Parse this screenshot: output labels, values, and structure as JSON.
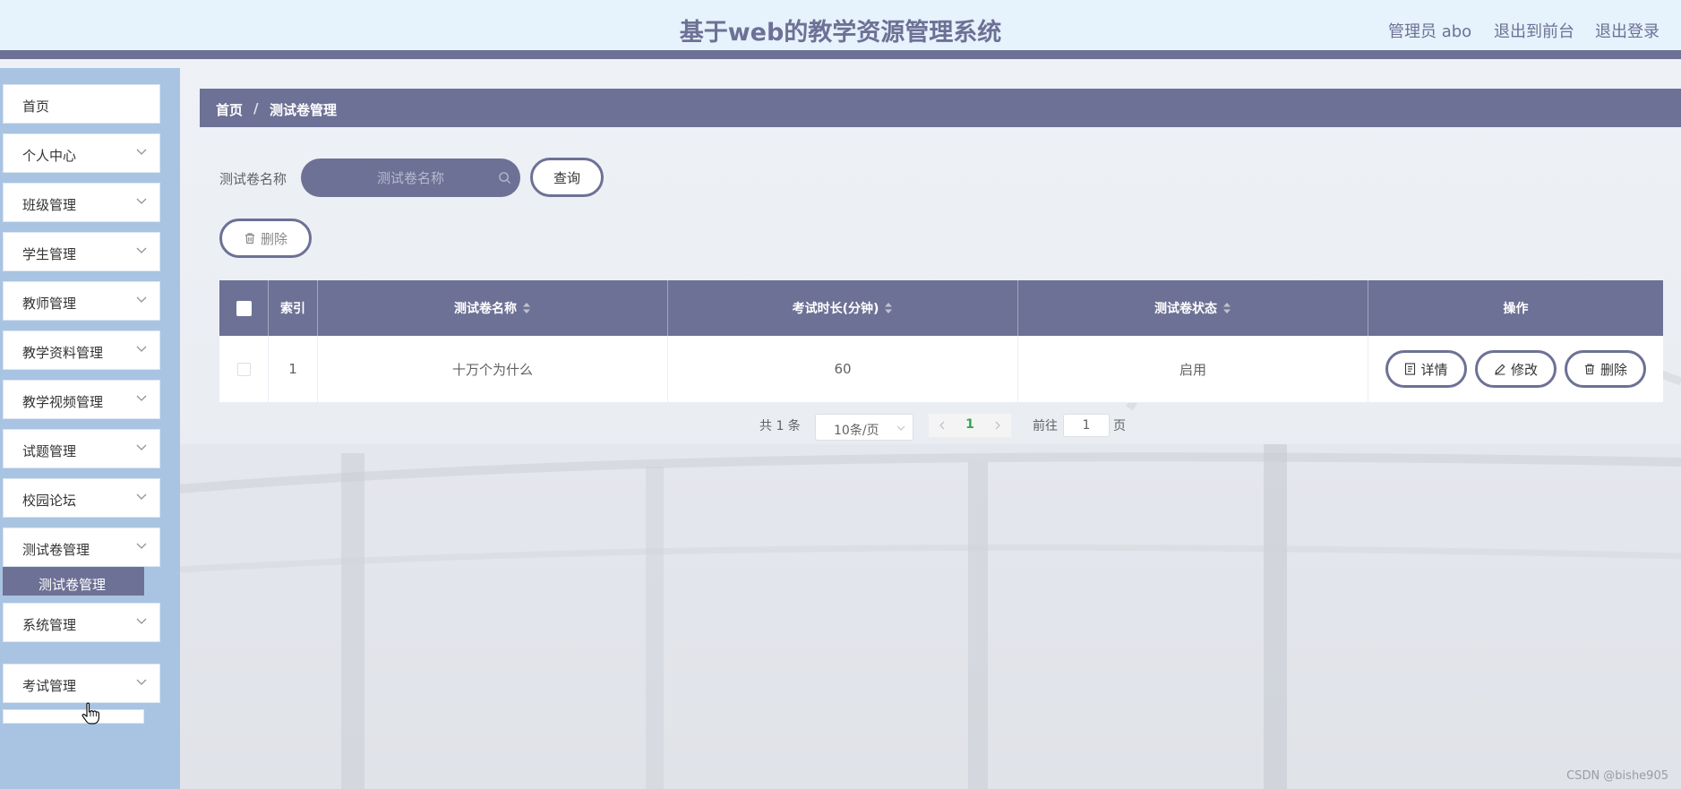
{
  "header": {
    "title": "基于web的教学资源管理系统",
    "admin_label": "管理员 abo",
    "front_link": "退出到前台",
    "logout_link": "退出登录"
  },
  "sidebar": {
    "items": [
      {
        "label": "首页"
      },
      {
        "label": "个人中心"
      },
      {
        "label": "班级管理"
      },
      {
        "label": "学生管理"
      },
      {
        "label": "教师管理"
      },
      {
        "label": "教学资料管理"
      },
      {
        "label": "教学视频管理"
      },
      {
        "label": "试题管理"
      },
      {
        "label": "校园论坛"
      },
      {
        "label": "测试卷管理"
      },
      {
        "label": "系统管理"
      },
      {
        "label": "考试管理"
      }
    ],
    "submenu_active": "测试卷管理"
  },
  "breadcrumb": {
    "home": "首页",
    "separator": "/",
    "current": "测试卷管理"
  },
  "search": {
    "label": "测试卷名称",
    "placeholder": "测试卷名称",
    "query_button": "查询"
  },
  "toolbar": {
    "delete_button": "删除"
  },
  "table": {
    "headers": [
      "索引",
      "测试卷名称",
      "考试时长(分钟)",
      "测试卷状态",
      "操作"
    ],
    "rows": [
      {
        "index": "1",
        "name": "十万个为什么",
        "duration": "60",
        "status": "启用"
      }
    ],
    "actions": {
      "detail": "详情",
      "edit": "修改",
      "delete": "删除"
    }
  },
  "pagination": {
    "total": "共 1 条",
    "page_size": "10条/页",
    "current_page": "1",
    "goto_label": "前往",
    "goto_value": "1",
    "page_suffix": "页"
  },
  "watermark": "CSDN @bishe905",
  "colors": {
    "theme": "#6d7195",
    "header_bg": "#e6f2fc",
    "sidebar_bg": "#a9c4e2",
    "active_page": "#3aa64f"
  }
}
